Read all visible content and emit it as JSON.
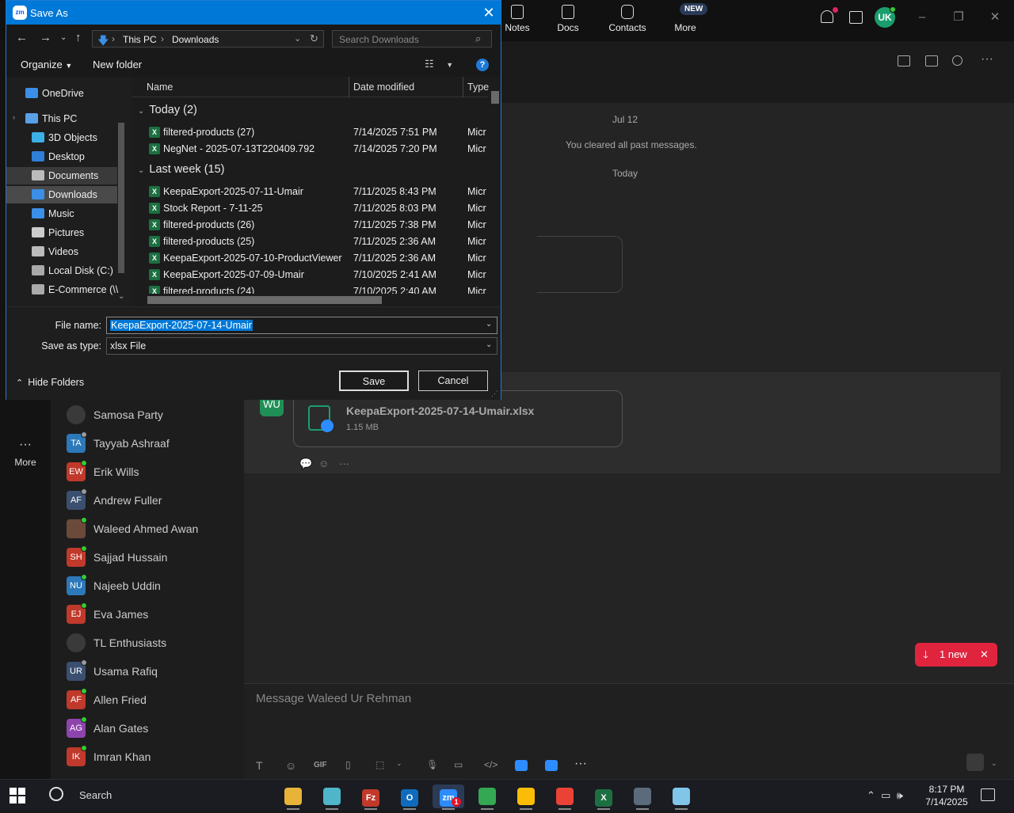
{
  "zoom": {
    "top_nav": [
      {
        "label": "Notes",
        "icon": "notes-icon"
      },
      {
        "label": "Docs",
        "icon": "docs-icon"
      },
      {
        "label": "Contacts",
        "icon": "contacts-icon"
      },
      {
        "label": "More",
        "icon": "more-icon"
      }
    ],
    "new_badge": "NEW",
    "user_initials": "UK",
    "rail_more": "More",
    "contacts": [
      {
        "name": "Samosa Party",
        "initials": "",
        "color": "#3a3a3a",
        "lock": true
      },
      {
        "name": "Tayyab Ashraaf",
        "initials": "TA",
        "color": "#2c78b8",
        "dot": "#999"
      },
      {
        "name": "Erik Wills",
        "initials": "EW",
        "color": "#c0392b",
        "dot": "#3c3"
      },
      {
        "name": "Andrew Fuller",
        "initials": "AF",
        "color": "#3b5070",
        "dot": "#999"
      },
      {
        "name": "Waleed Ahmed Awan",
        "initials": "",
        "color": "#6b4a3a",
        "dot": "#3c3"
      },
      {
        "name": "Sajjad Hussain",
        "initials": "SH",
        "color": "#c0392b",
        "dot": "#3c3"
      },
      {
        "name": "Najeeb Uddin",
        "initials": "NU",
        "color": "#2c78b8",
        "dot": "#3c3"
      },
      {
        "name": "Eva James",
        "initials": "EJ",
        "color": "#c0392b",
        "dot": "#3c3"
      },
      {
        "name": "TL Enthusiasts",
        "initials": "",
        "color": "#3a3a3a",
        "lock": true
      },
      {
        "name": "Usama Rafiq",
        "initials": "UR",
        "color": "#3b5070",
        "dot": "#999"
      },
      {
        "name": "Allen Fried",
        "initials": "AF",
        "color": "#c0392b",
        "dot": "#3c3"
      },
      {
        "name": "Alan Gates",
        "initials": "AG",
        "color": "#8e44ad",
        "dot": "#3c3"
      },
      {
        "name": "Imran Khan",
        "initials": "IK",
        "color": "#c0392b",
        "dot": "#3c3"
      }
    ],
    "chat": {
      "date_label": "Jul 12",
      "cleared_text": "You cleared all past messages.",
      "today_label": "Today",
      "sender_initials": "WU",
      "file_name": "KeepaExport-2025-07-14-Umair.xlsx",
      "file_size": "1.15 MB",
      "new_pill": "1 new",
      "composer_placeholder": "Message Waleed Ur Rehman",
      "gif_label": "GIF"
    }
  },
  "dialog": {
    "title": "Save As",
    "address": {
      "root": "This PC",
      "folder": "Downloads"
    },
    "search_placeholder": "Search Downloads",
    "organize": "Organize",
    "new_folder": "New folder",
    "help": "?",
    "nav_items": [
      {
        "label": "OneDrive",
        "icon": "onedrive-icon",
        "color": "#3b8fe6",
        "indent": 0
      },
      {
        "label": "This PC",
        "icon": "computer-icon",
        "color": "#5aa0e6",
        "indent": 0
      },
      {
        "label": "3D Objects",
        "icon": "cube-icon",
        "color": "#3bb0e6",
        "indent": 1
      },
      {
        "label": "Desktop",
        "icon": "desktop-icon",
        "color": "#2f7fd6",
        "indent": 1
      },
      {
        "label": "Documents",
        "icon": "documents-icon",
        "color": "#bbbbbb",
        "indent": 1,
        "selected": "light"
      },
      {
        "label": "Downloads",
        "icon": "downloads-icon",
        "color": "#3b8fe6",
        "indent": 1,
        "selected": "dark"
      },
      {
        "label": "Music",
        "icon": "music-icon",
        "color": "#3b8fe6",
        "indent": 1
      },
      {
        "label": "Pictures",
        "icon": "pictures-icon",
        "color": "#cccccc",
        "indent": 1
      },
      {
        "label": "Videos",
        "icon": "videos-icon",
        "color": "#bbbbbb",
        "indent": 1
      },
      {
        "label": "Local Disk (C:)",
        "icon": "disk-icon",
        "color": "#aaaaaa",
        "indent": 1
      },
      {
        "label": "E-Commerce (\\\\",
        "icon": "network-drive-icon",
        "color": "#aaaaaa",
        "indent": 1
      }
    ],
    "columns": {
      "name": "Name",
      "date": "Date modified",
      "type": "Type"
    },
    "groups": [
      {
        "label": "Today (2)",
        "files": [
          {
            "name": "filtered-products (27)",
            "date": "7/14/2025 7:51 PM",
            "type": "Micr"
          },
          {
            "name": "NegNet - 2025-07-13T220409.792",
            "date": "7/14/2025 7:20 PM",
            "type": "Micr"
          }
        ]
      },
      {
        "label": "Last week (15)",
        "files": [
          {
            "name": "KeepaExport-2025-07-11-Umair",
            "date": "7/11/2025 8:43 PM",
            "type": "Micr"
          },
          {
            "name": "Stock Report - 7-11-25",
            "date": "7/11/2025 8:03 PM",
            "type": "Micr"
          },
          {
            "name": "filtered-products (26)",
            "date": "7/11/2025 7:38 PM",
            "type": "Micr"
          },
          {
            "name": "filtered-products (25)",
            "date": "7/11/2025 2:36 AM",
            "type": "Micr"
          },
          {
            "name": "KeepaExport-2025-07-10-ProductViewer",
            "date": "7/11/2025 2:36 AM",
            "type": "Micr"
          },
          {
            "name": "KeepaExport-2025-07-09-Umair",
            "date": "7/10/2025 2:41 AM",
            "type": "Micr"
          },
          {
            "name": "filtered-products (24)",
            "date": "7/10/2025 2:40 AM",
            "type": "Micr"
          }
        ]
      }
    ],
    "file_name_label": "File name:",
    "file_name_value": "KeepaExport-2025-07-14-Umair",
    "save_type_label": "Save as type:",
    "save_type_value": "xlsx File",
    "save_button": "Save",
    "cancel_button": "Cancel",
    "hide_folders": "Hide Folders"
  },
  "taskbar": {
    "search_label": "Search",
    "time": "8:17 PM",
    "date": "7/14/2025",
    "apps": [
      {
        "name": "file-explorer-app",
        "label": "",
        "color": "#e8b339"
      },
      {
        "name": "app-2",
        "label": "",
        "color": "#4fb6c9"
      },
      {
        "name": "filezilla-app",
        "label": "Fz",
        "color": "#c0392b"
      },
      {
        "name": "outlook-app",
        "label": "O",
        "color": "#0f6cbd"
      },
      {
        "name": "zoom-app",
        "label": "zm",
        "color": "#2d8cff",
        "badge": "1"
      },
      {
        "name": "chrome-app-1",
        "label": "",
        "color": "#34a853"
      },
      {
        "name": "chrome-app-2",
        "label": "",
        "color": "#fbbc05"
      },
      {
        "name": "chrome-app-3",
        "label": "",
        "color": "#ea4335"
      },
      {
        "name": "excel-app",
        "label": "X",
        "color": "#1d6f42"
      },
      {
        "name": "calculator-app",
        "label": "",
        "color": "#5b6b7b"
      },
      {
        "name": "app-11",
        "label": "",
        "color": "#7fc6e8"
      }
    ]
  }
}
